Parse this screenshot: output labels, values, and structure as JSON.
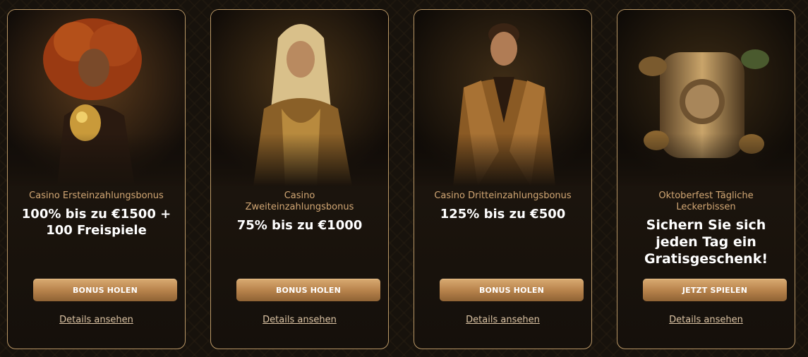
{
  "offers": [
    {
      "subtitle": "Casino Ersteinzahlungsbonus",
      "headline_lines": [
        "100% bis zu €1500 +",
        "100 Freispiele"
      ],
      "button_label": "BONUS HOLEN",
      "details_label": "Details ansehen",
      "image": "red-haired-woman-with-golden-dice-illustration"
    },
    {
      "subtitle_lines": [
        "Casino",
        "Zweiteinzahlungsbonus"
      ],
      "headline_lines": [
        "75% bis zu €1000"
      ],
      "button_label": "BONUS HOLEN",
      "details_label": "Details ansehen",
      "image": "blonde-woman-in-gold-dress-illustration"
    },
    {
      "subtitle": "Casino Dritteinzahlungsbonus",
      "headline_lines": [
        "125% bis zu €500"
      ],
      "button_label": "BONUS HOLEN",
      "details_label": "Details ansehen",
      "image": "man-in-gold-suit-illustration"
    },
    {
      "subtitle_lines": [
        "Oktoberfest Tägliche",
        "Leckerbissen"
      ],
      "headline_lines": [
        "Sichern Sie sich",
        "jeden Tag ein",
        "Gratisgeschenk!"
      ],
      "button_label": "JETZT SPIELEN",
      "details_label": "Details ansehen",
      "image": "golden-beer-keg-with-hops-illustration"
    }
  ],
  "colors": {
    "accent_gold": "#d2a774",
    "button_gradient_top": "#d9ab72",
    "button_gradient_bottom": "#8f6334",
    "card_border": "#b99766",
    "background": "#17120c"
  }
}
